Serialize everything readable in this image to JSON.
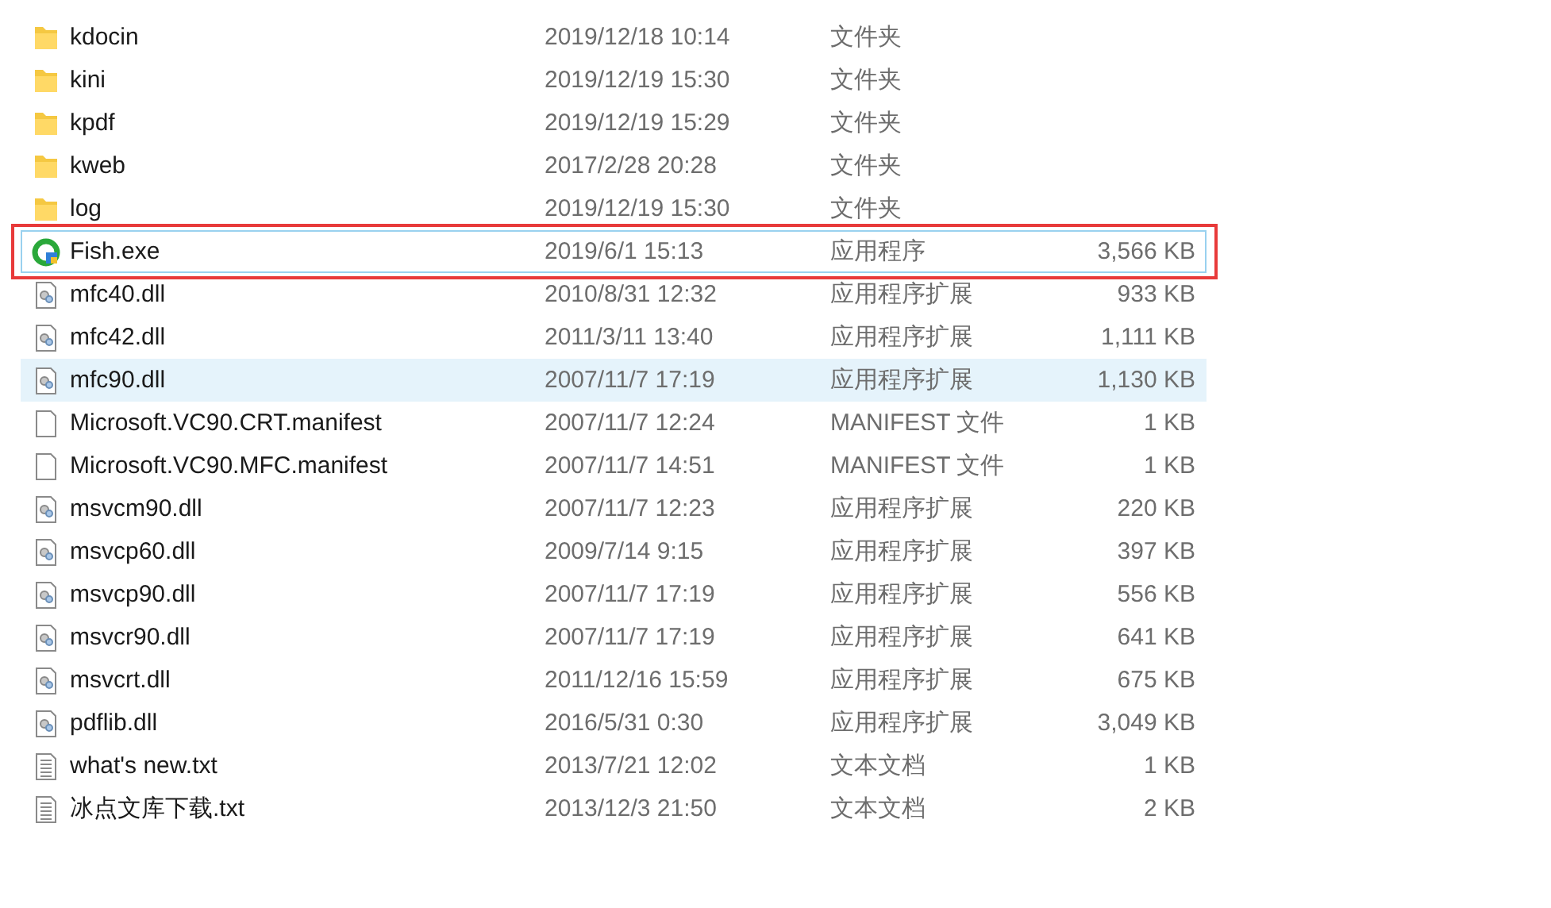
{
  "files": [
    {
      "kind": "folder",
      "name": "kdocin",
      "modified": "2019/12/18 10:14",
      "type": "文件夹",
      "selected": false,
      "focused": false,
      "annotated": false
    },
    {
      "kind": "folder",
      "name": "kini",
      "modified": "2019/12/19 15:30",
      "type": "文件夹",
      "selected": false,
      "focused": false,
      "annotated": false
    },
    {
      "kind": "folder",
      "name": "kpdf",
      "modified": "2019/12/19 15:29",
      "type": "文件夹",
      "selected": false,
      "focused": false,
      "annotated": false
    },
    {
      "kind": "folder",
      "name": "kweb",
      "modified": "2017/2/28 20:28",
      "type": "文件夹",
      "selected": false,
      "focused": false,
      "annotated": false
    },
    {
      "kind": "folder",
      "name": "log",
      "modified": "2019/12/19 15:30",
      "type": "文件夹",
      "selected": false,
      "focused": false,
      "annotated": false
    },
    {
      "kind": "exe",
      "name": "Fish.exe",
      "modified": "2019/6/1 15:13",
      "type": "应用程序",
      "size": "3,566 KB",
      "selected": false,
      "focused": true,
      "annotated": true
    },
    {
      "kind": "dll",
      "name": "mfc40.dll",
      "modified": "2010/8/31 12:32",
      "type": "应用程序扩展",
      "size": "933 KB",
      "selected": false,
      "focused": false,
      "annotated": false
    },
    {
      "kind": "dll",
      "name": "mfc42.dll",
      "modified": "2011/3/11 13:40",
      "type": "应用程序扩展",
      "size": "1,111 KB",
      "selected": false,
      "focused": false,
      "annotated": false
    },
    {
      "kind": "dll",
      "name": "mfc90.dll",
      "modified": "2007/11/7 17:19",
      "type": "应用程序扩展",
      "size": "1,130 KB",
      "selected": true,
      "focused": false,
      "annotated": false
    },
    {
      "kind": "file",
      "name": "Microsoft.VC90.CRT.manifest",
      "modified": "2007/11/7 12:24",
      "type": "MANIFEST 文件",
      "size": "1 KB",
      "selected": false,
      "focused": false,
      "annotated": false
    },
    {
      "kind": "file",
      "name": "Microsoft.VC90.MFC.manifest",
      "modified": "2007/11/7 14:51",
      "type": "MANIFEST 文件",
      "size": "1 KB",
      "selected": false,
      "focused": false,
      "annotated": false
    },
    {
      "kind": "dll",
      "name": "msvcm90.dll",
      "modified": "2007/11/7 12:23",
      "type": "应用程序扩展",
      "size": "220 KB",
      "selected": false,
      "focused": false,
      "annotated": false
    },
    {
      "kind": "dll",
      "name": "msvcp60.dll",
      "modified": "2009/7/14 9:15",
      "type": "应用程序扩展",
      "size": "397 KB",
      "selected": false,
      "focused": false,
      "annotated": false
    },
    {
      "kind": "dll",
      "name": "msvcp90.dll",
      "modified": "2007/11/7 17:19",
      "type": "应用程序扩展",
      "size": "556 KB",
      "selected": false,
      "focused": false,
      "annotated": false
    },
    {
      "kind": "dll",
      "name": "msvcr90.dll",
      "modified": "2007/11/7 17:19",
      "type": "应用程序扩展",
      "size": "641 KB",
      "selected": false,
      "focused": false,
      "annotated": false
    },
    {
      "kind": "dll",
      "name": "msvcrt.dll",
      "modified": "2011/12/16 15:59",
      "type": "应用程序扩展",
      "size": "675 KB",
      "selected": false,
      "focused": false,
      "annotated": false
    },
    {
      "kind": "dll",
      "name": "pdflib.dll",
      "modified": "2016/5/31 0:30",
      "type": "应用程序扩展",
      "size": "3,049 KB",
      "selected": false,
      "focused": false,
      "annotated": false
    },
    {
      "kind": "text",
      "name": "what's new.txt",
      "modified": "2013/7/21 12:02",
      "type": "文本文档",
      "size": "1 KB",
      "selected": false,
      "focused": false,
      "annotated": false
    },
    {
      "kind": "text",
      "name": "冰点文库下载.txt",
      "modified": "2013/12/3 21:50",
      "type": "文本文档",
      "size": "2 KB",
      "selected": false,
      "focused": false,
      "annotated": false
    }
  ]
}
